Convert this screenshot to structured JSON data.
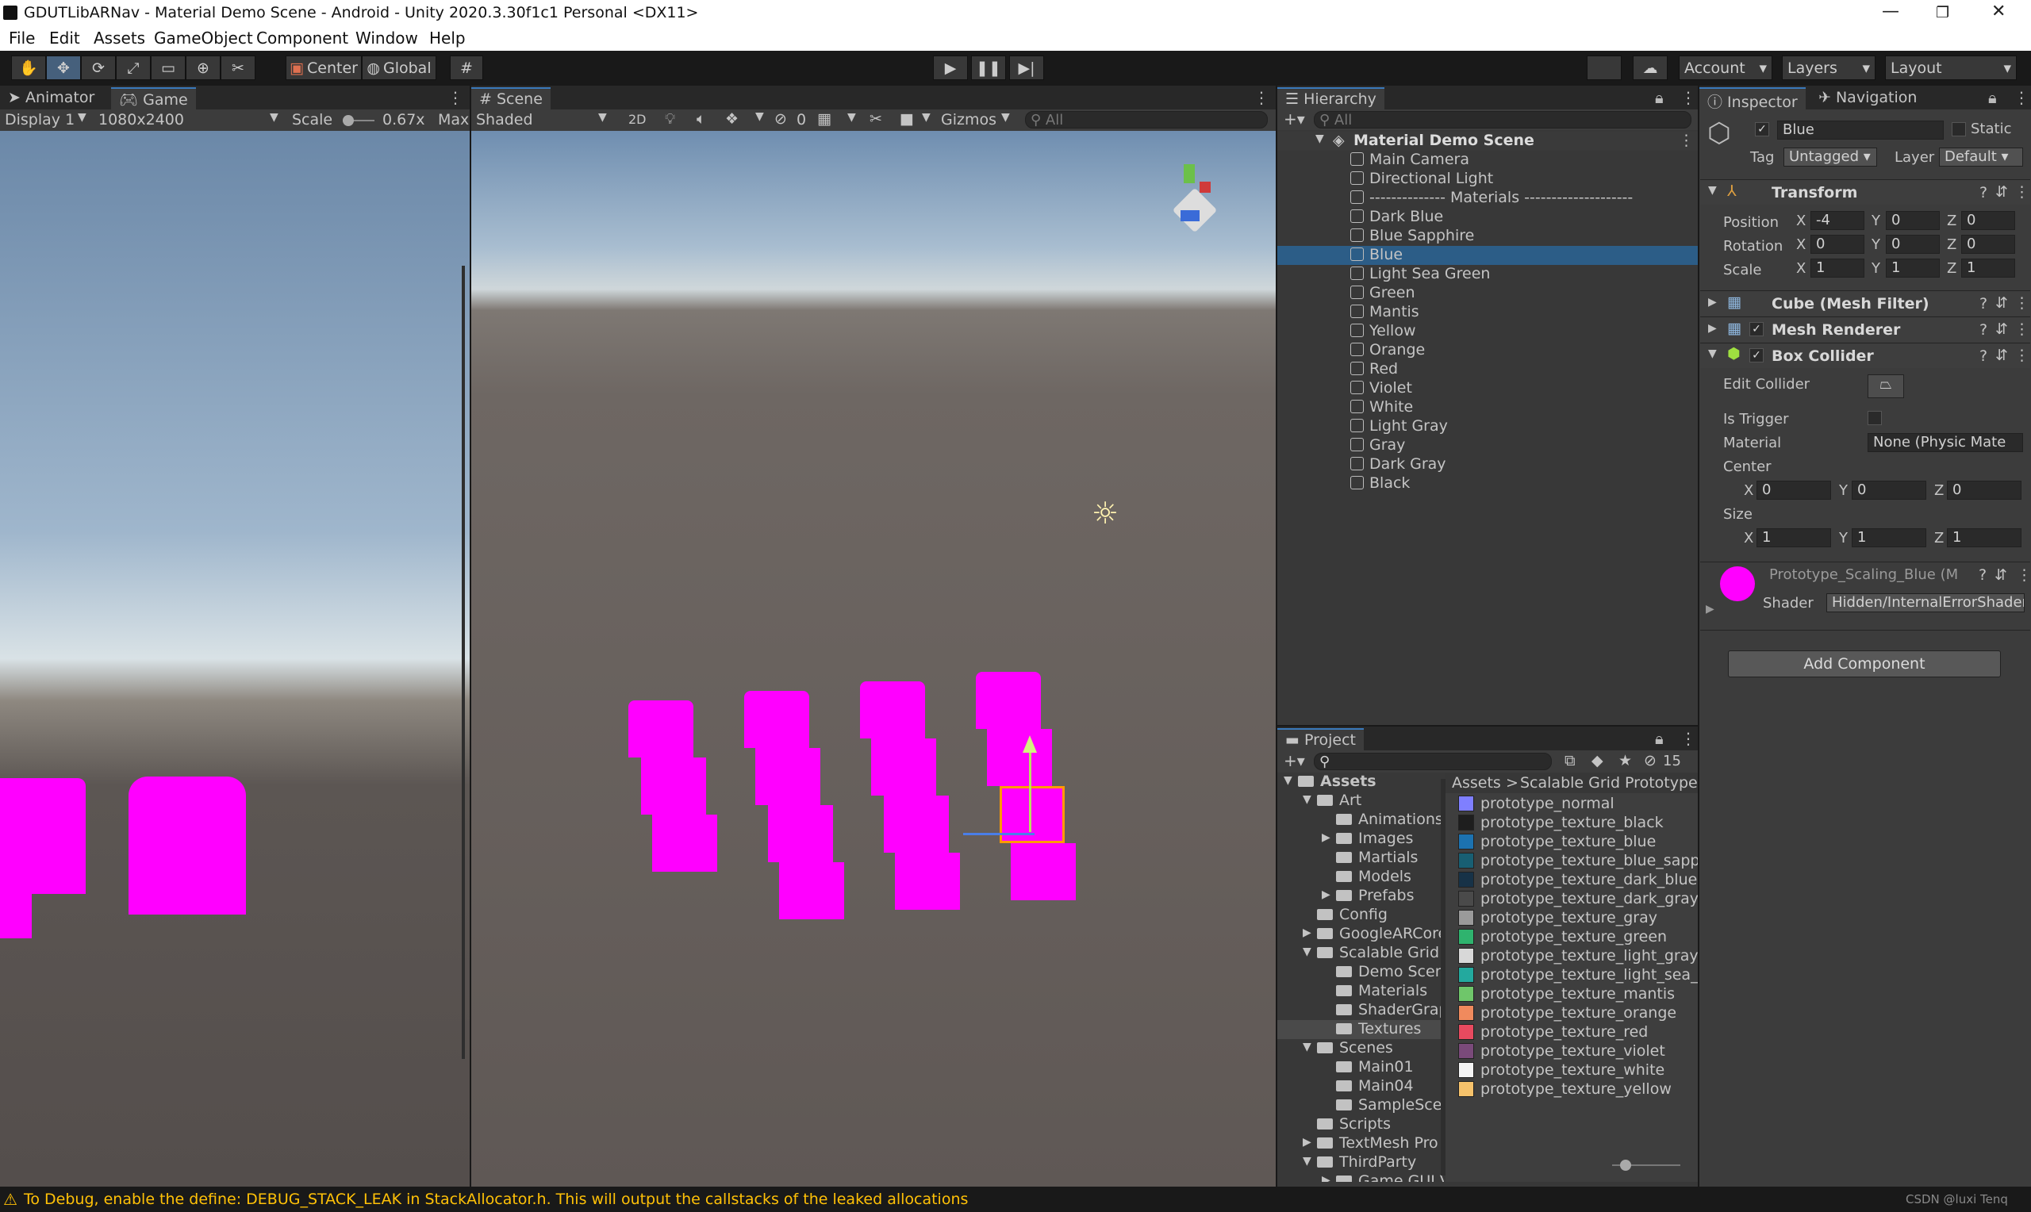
{
  "window": {
    "title": "GDUTLibARNav - Material Demo Scene - Android - Unity 2020.3.30f1c1 Personal <DX11>",
    "min": "—",
    "max": "❐",
    "close": "✕"
  },
  "menu": [
    "File",
    "Edit",
    "Assets",
    "GameObject",
    "Component",
    "Window",
    "Help"
  ],
  "toolbar": {
    "pivot": "Center",
    "space": "Global",
    "account": "Account",
    "layers": "Layers",
    "layout": "Layout"
  },
  "game": {
    "tab_animator": "Animator",
    "tab_game": "Game",
    "display": "Display 1",
    "resolution": "1080x2400",
    "scale_label": "Scale",
    "scale_value": "0.67x",
    "max": "Max"
  },
  "scene": {
    "tab": "Scene",
    "shading": "Shaded",
    "mode2d": "2D",
    "hidden_count": "0",
    "gizmos": "Gizmos",
    "search_placeholder": "All"
  },
  "hierarchy": {
    "tab": "Hierarchy",
    "search_placeholder": "All",
    "root": "Material Demo Scene",
    "items": [
      "Main Camera",
      "Directional Light",
      "-------------- Materials --------------------",
      "Dark Blue",
      "Blue Sapphire",
      "Blue",
      "Light Sea Green",
      "Green",
      "Mantis",
      "Yellow",
      "Orange",
      "Red",
      "Violet",
      "White",
      "Light Gray",
      "Gray",
      "Dark Gray",
      "Black"
    ],
    "selected_index": 5
  },
  "project": {
    "tab": "Project",
    "badge_count": "15",
    "tree": [
      {
        "label": "Assets",
        "depth": 0,
        "arrow": "▼",
        "bold": true
      },
      {
        "label": "Art",
        "depth": 1,
        "arrow": "▼"
      },
      {
        "label": "Animations",
        "depth": 2,
        "arrow": ""
      },
      {
        "label": "Images",
        "depth": 2,
        "arrow": "▶"
      },
      {
        "label": "Martials",
        "depth": 2,
        "arrow": ""
      },
      {
        "label": "Models",
        "depth": 2,
        "arrow": ""
      },
      {
        "label": "Prefabs",
        "depth": 2,
        "arrow": "▶"
      },
      {
        "label": "Config",
        "depth": 1,
        "arrow": ""
      },
      {
        "label": "GoogleARCore",
        "depth": 1,
        "arrow": "▶"
      },
      {
        "label": "Scalable Grid F",
        "depth": 1,
        "arrow": "▼"
      },
      {
        "label": "Demo Scene",
        "depth": 2,
        "arrow": ""
      },
      {
        "label": "Materials",
        "depth": 2,
        "arrow": ""
      },
      {
        "label": "ShaderGraph",
        "depth": 2,
        "arrow": ""
      },
      {
        "label": "Textures",
        "depth": 2,
        "arrow": "",
        "selected": true
      },
      {
        "label": "Scenes",
        "depth": 1,
        "arrow": "▼"
      },
      {
        "label": "Main01",
        "depth": 2,
        "arrow": ""
      },
      {
        "label": "Main04",
        "depth": 2,
        "arrow": ""
      },
      {
        "label": "SampleScen",
        "depth": 2,
        "arrow": ""
      },
      {
        "label": "Scripts",
        "depth": 1,
        "arrow": ""
      },
      {
        "label": "TextMesh Pro",
        "depth": 1,
        "arrow": "▶"
      },
      {
        "label": "ThirdParty",
        "depth": 1,
        "arrow": "▼"
      },
      {
        "label": "Game GUI V",
        "depth": 2,
        "arrow": "▶"
      }
    ],
    "breadcrumb_root": "Assets",
    "breadcrumb_sep": ">",
    "breadcrumb_current": "Scalable Grid Prototype M",
    "files": [
      {
        "name": "prototype_normal",
        "color": "#7f7fff"
      },
      {
        "name": "prototype_texture_black",
        "color": "#1e1e1e"
      },
      {
        "name": "prototype_texture_blue",
        "color": "#1c72b0"
      },
      {
        "name": "prototype_texture_blue_sapphire",
        "color": "#185f73"
      },
      {
        "name": "prototype_texture_dark_blue",
        "color": "#173247"
      },
      {
        "name": "prototype_texture_dark_gray",
        "color": "#4a4a4a"
      },
      {
        "name": "prototype_texture_gray",
        "color": "#9a9a9a"
      },
      {
        "name": "prototype_texture_green",
        "color": "#2fb36e"
      },
      {
        "name": "prototype_texture_light_gray",
        "color": "#d8d8d8"
      },
      {
        "name": "prototype_texture_light_sea_green",
        "color": "#23a99e"
      },
      {
        "name": "prototype_texture_mantis",
        "color": "#6fc66a"
      },
      {
        "name": "prototype_texture_orange",
        "color": "#f08a5d"
      },
      {
        "name": "prototype_texture_red",
        "color": "#e84a5f"
      },
      {
        "name": "prototype_texture_violet",
        "color": "#7a4a7a"
      },
      {
        "name": "prototype_texture_white",
        "color": "#f4f4f4"
      },
      {
        "name": "prototype_texture_yellow",
        "color": "#f5c26b"
      }
    ]
  },
  "inspector": {
    "tab": "Inspector",
    "tab2": "Navigation",
    "object_name": "Blue",
    "static_label": "Static",
    "tag_label": "Tag",
    "tag": "Untagged",
    "layer_label": "Layer",
    "layer": "Default",
    "transform": {
      "title": "Transform",
      "position_label": "Position",
      "rotation_label": "Rotation",
      "scale_label": "Scale",
      "position": [
        "-4",
        "0",
        "0"
      ],
      "rotation": [
        "0",
        "0",
        "0"
      ],
      "scale": [
        "1",
        "1",
        "1"
      ]
    },
    "axes": [
      "X",
      "Y",
      "Z"
    ],
    "mesh_filter": "Cube (Mesh Filter)",
    "mesh_renderer": "Mesh Renderer",
    "box_collider": "Box Collider",
    "edit_collider": "Edit Collider",
    "is_trigger": "Is Trigger",
    "material_label": "Material",
    "material_value": "None (Physic Mate",
    "center_label": "Center",
    "center": [
      "0",
      "0",
      "0"
    ],
    "size_label": "Size",
    "size": [
      "1",
      "1",
      "1"
    ],
    "mat_name": "Prototype_Scaling_Blue (M",
    "shader_label": "Shader",
    "shader_value": "Hidden/InternalErrorShader",
    "add_component": "Add Component"
  },
  "status": {
    "message": "To Debug, enable the define: DEBUG_STACK_LEAK in StackAllocator.h. This will output the callstacks of the leaked allocations",
    "right": "CSDN @luxi Tenq"
  },
  "colors": {
    "accent": "#3a79bb",
    "selection": "#2c5d87",
    "error_material": "#ff00ff",
    "warning": "#ffc107"
  }
}
